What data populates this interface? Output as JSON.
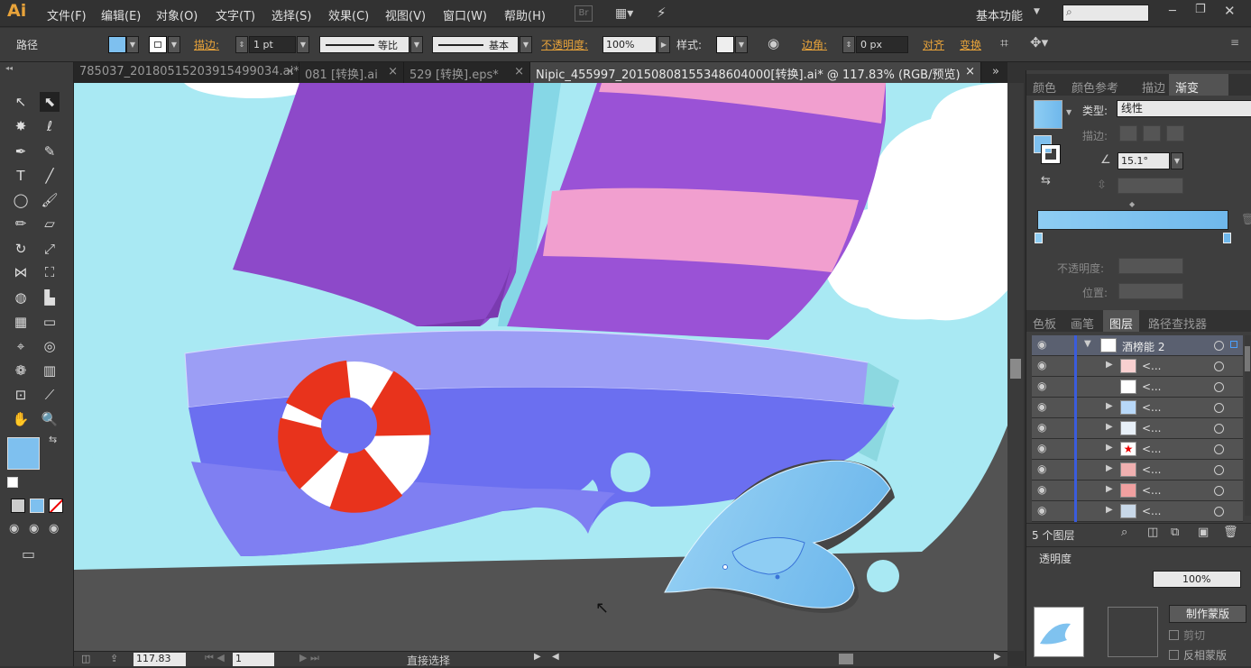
{
  "app": {
    "logo": "Ai",
    "workspace": "基本功能",
    "search_placeholder": ""
  },
  "menu": [
    "文件(F)",
    "编辑(E)",
    "对象(O)",
    "文字(T)",
    "选择(S)",
    "效果(C)",
    "视图(V)",
    "窗口(W)",
    "帮助(H)"
  ],
  "menu_extra": {
    "br_label": "Br"
  },
  "control": {
    "selection": "路径",
    "stroke_label": "描边:",
    "stroke_value": "1 pt",
    "profile_label": "等比",
    "brush_label": "基本",
    "opacity_label": "不透明度:",
    "opacity_value": "100%",
    "style_label": "样式:",
    "corner_label": "边角:",
    "corner_value": "0 px",
    "align_label": "对齐",
    "transform_label": "变换"
  },
  "tabs": [
    {
      "label": "785037_20180515203915499034.ai*",
      "close": "×"
    },
    {
      "label": "081 [转换].ai",
      "close": "×"
    },
    {
      "label": "529 [转换].eps*",
      "close": "×"
    },
    {
      "label": "Nipic_455997_20150808155348604000[转换].ai* @ 117.83% (RGB/预览)",
      "close": "×"
    }
  ],
  "status": {
    "zoom": "117.83",
    "page": "1",
    "tool": "直接选择"
  },
  "gradient_panel": {
    "tabs": [
      "颜色",
      "颜色参考",
      "描边",
      "渐变"
    ],
    "type_label": "类型:",
    "type_value": "线性",
    "stroke_label": "描边:",
    "angle_value": "15.1°",
    "opacity_label": "不透明度:",
    "position_label": "位置:",
    "colors": {
      "start": "#8ecdf3",
      "end": "#6fb8ec"
    }
  },
  "layers_panel": {
    "tabs": [
      "色板",
      "画笔",
      "图层",
      "路径查找器"
    ],
    "layer_name": "酒榜能 2",
    "sublayers": [
      "<...",
      "<...",
      "<...",
      "<...",
      "<...",
      "<...",
      "<...",
      "<..."
    ],
    "count_label": "5 个图层"
  },
  "transparency_panel": {
    "title": "透明度",
    "opacity_value": "100%",
    "make_mask": "制作蒙版",
    "clip_label": "剪切",
    "invert_label": "反相蒙版"
  },
  "colors": {
    "sky": "#a9e9f3",
    "sail_purple": "#8d49c9",
    "boat_body": "#6b6ff0",
    "boat_rim": "#9c9ef5",
    "lifebuoy_red": "#e8331c",
    "wave_blue": "#7fc2ef",
    "pink_stripe": "#f19fcf",
    "cloud": "#ffffff",
    "fill_swatch": "#7ec0ef"
  }
}
